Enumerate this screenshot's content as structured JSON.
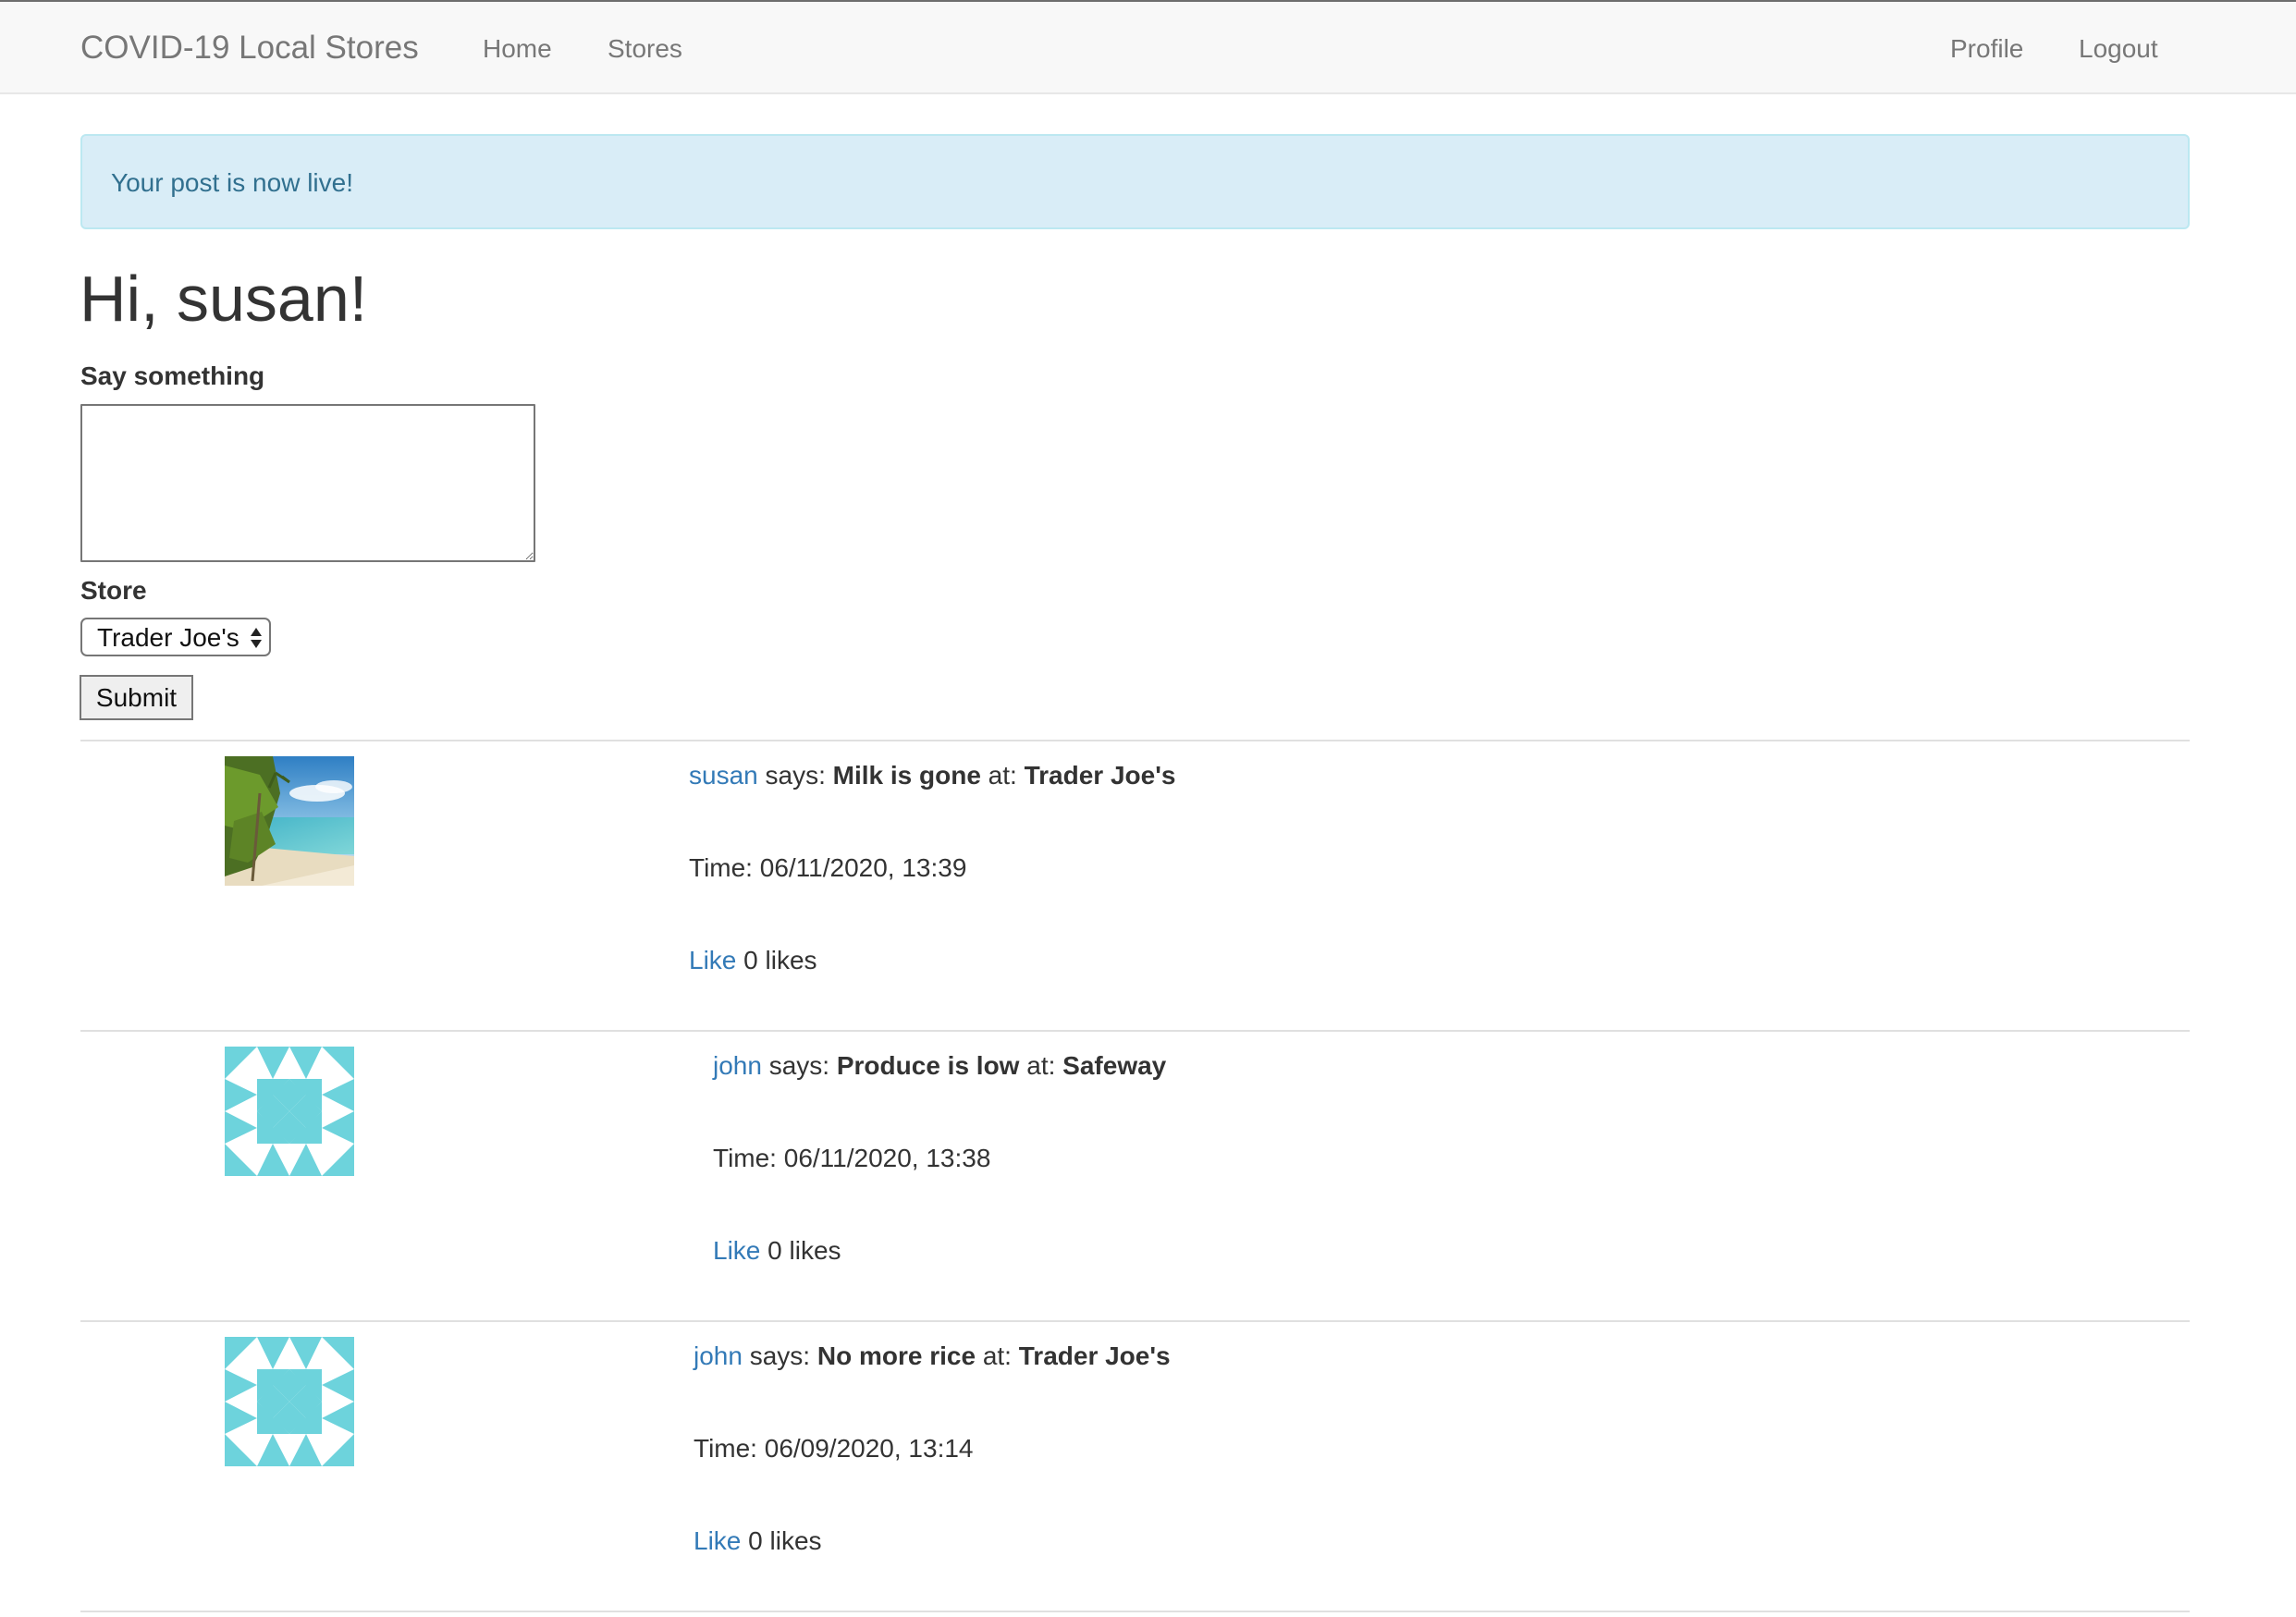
{
  "navbar": {
    "brand": "COVID-19 Local Stores",
    "left_links": [
      "Home",
      "Stores"
    ],
    "right_links": [
      "Profile",
      "Logout"
    ]
  },
  "alert": {
    "message": "Your post is now live!"
  },
  "greeting": "Hi, susan!",
  "form": {
    "post_label": "Say something",
    "post_value": "",
    "store_label": "Store",
    "store_selected": "Trader Joe's",
    "submit_label": "Submit"
  },
  "colors": {
    "link": "#337ab7",
    "alert_bg": "#d9edf7",
    "alert_text": "#31708f",
    "identicon": "#6dd3dc",
    "navbar_bg": "#f8f8f8"
  },
  "posts": [
    {
      "author": "susan",
      "says": "says:",
      "body": "Milk is gone",
      "at": "at:",
      "store": "Trader Joe's",
      "time": "Time: 06/11/2020, 13:39",
      "like_label": "Like",
      "likes": "0 likes",
      "avatar": "beach-photo-avatar"
    },
    {
      "author": "john",
      "says": "says:",
      "body": "Produce is low",
      "at": "at:",
      "store": "Safeway",
      "time": "Time: 06/11/2020, 13:38",
      "like_label": "Like",
      "likes": "0 likes",
      "avatar": "identicon-avatar"
    },
    {
      "author": "john",
      "says": "says:",
      "body": "No more rice",
      "at": "at:",
      "store": "Trader Joe's",
      "time": "Time: 06/09/2020, 13:14",
      "like_label": "Like",
      "likes": "0 likes",
      "avatar": "identicon-avatar"
    }
  ]
}
